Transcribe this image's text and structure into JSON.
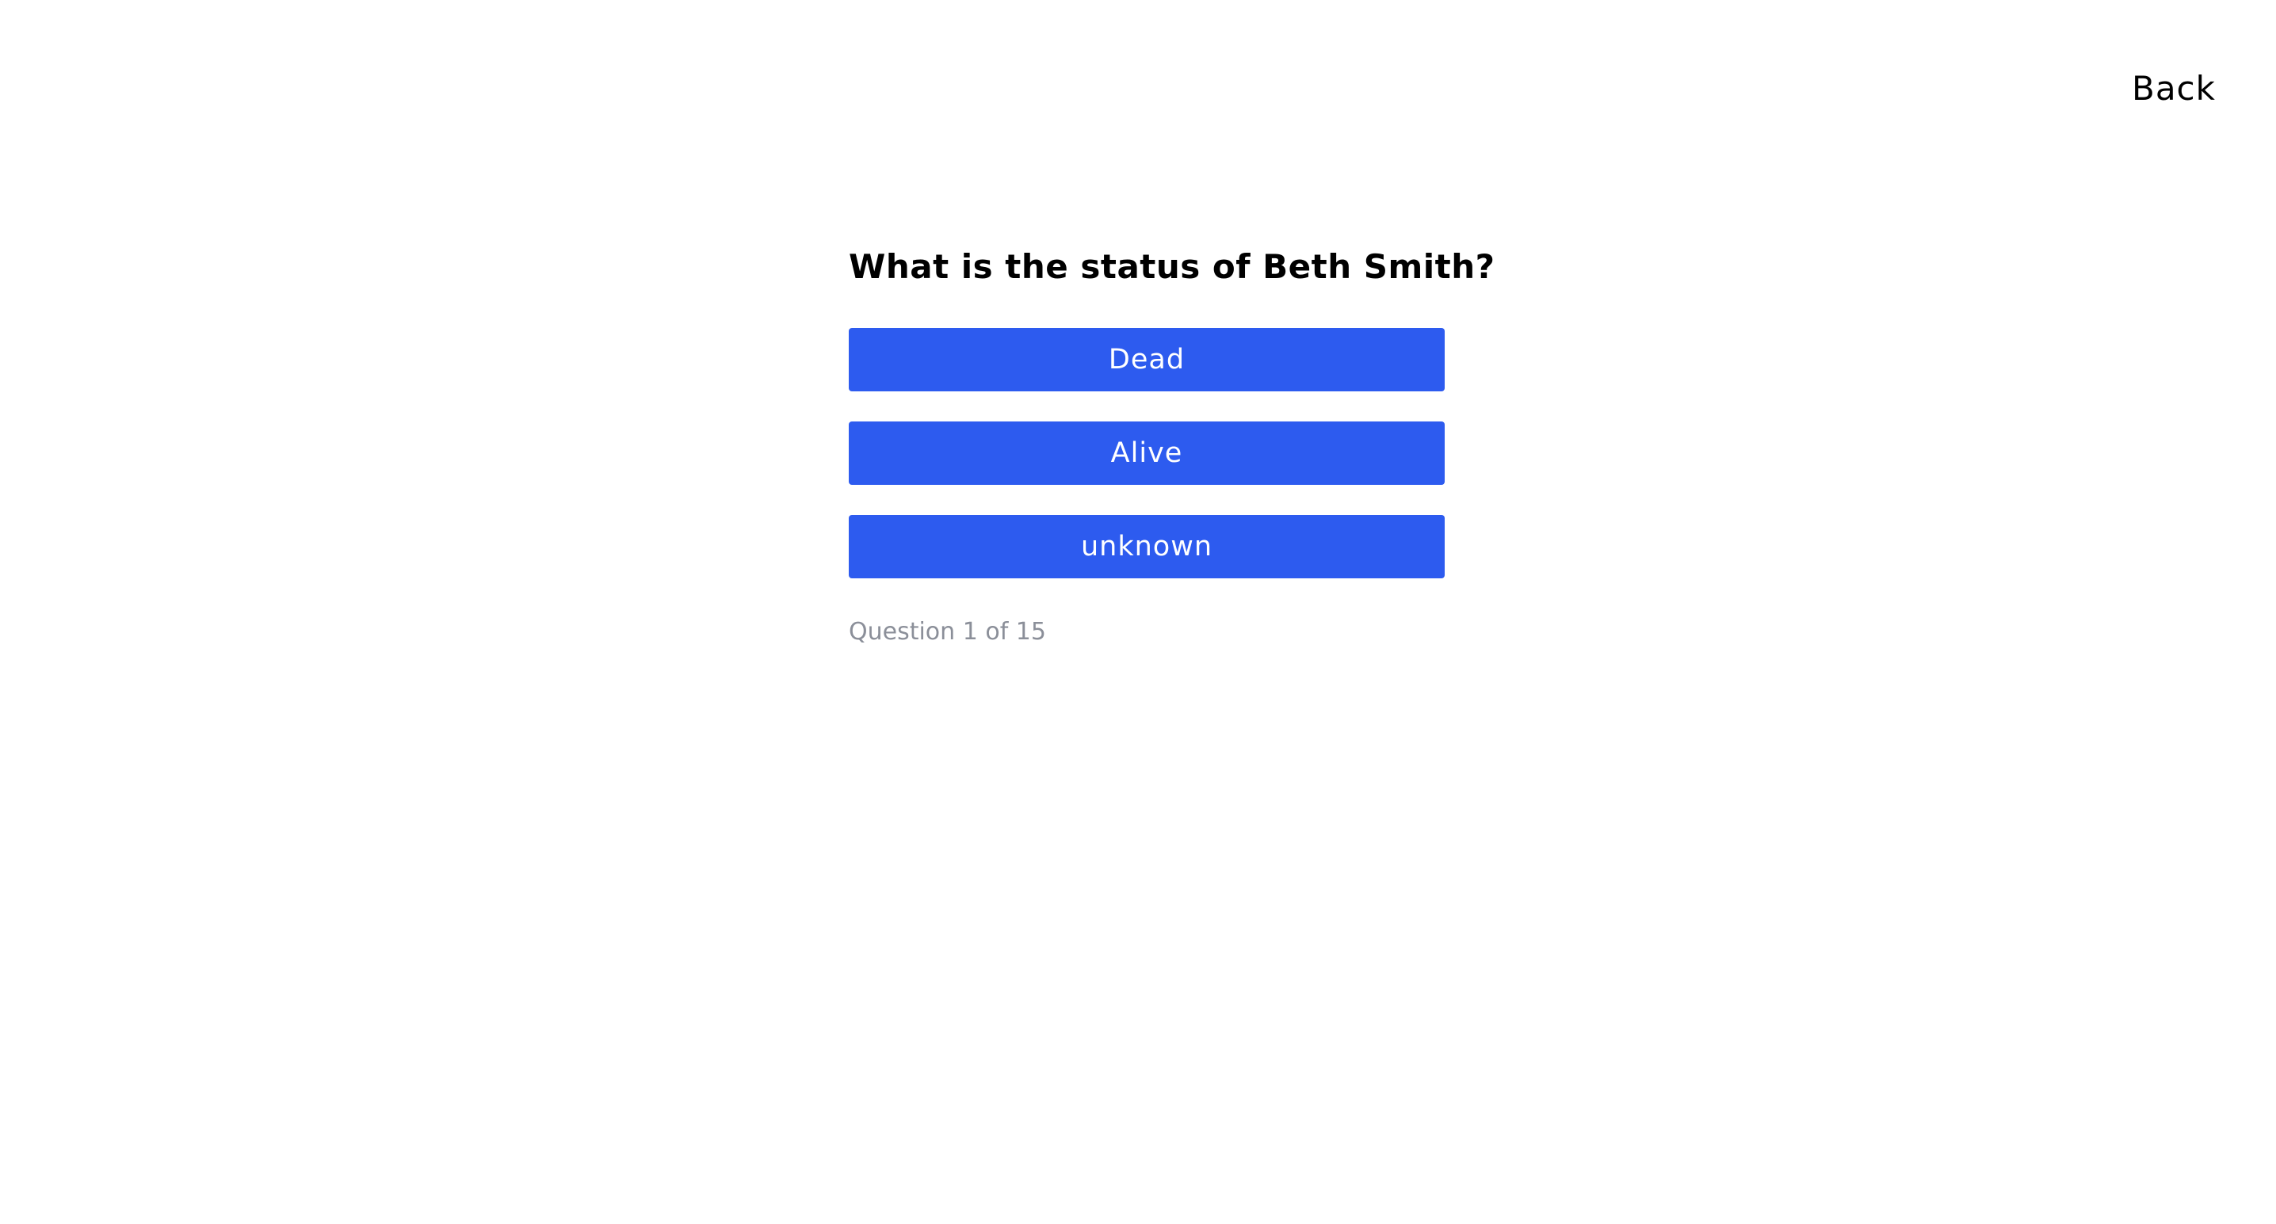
{
  "header": {
    "back_label": "Back"
  },
  "quiz": {
    "question": "What is the status of Beth Smith?",
    "answers": [
      {
        "label": "Dead"
      },
      {
        "label": "Alive"
      },
      {
        "label": "unknown"
      }
    ],
    "progress_text": "Question 1 of 15",
    "current_question": 1,
    "total_questions": 15
  },
  "colors": {
    "button_bg": "#2d5bef",
    "button_text": "#ffffff",
    "progress_text": "#8b8f99",
    "page_bg": "#ffffff"
  }
}
